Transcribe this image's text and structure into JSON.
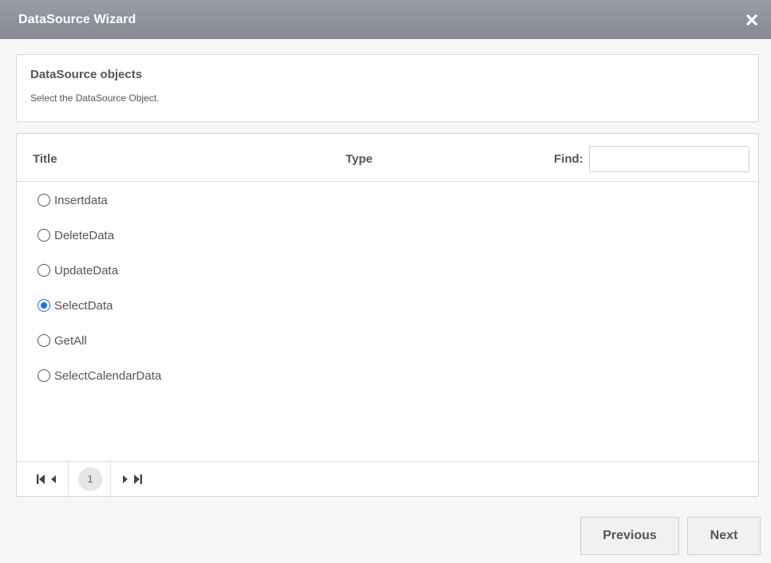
{
  "window": {
    "title": "DataSource Wizard",
    "close_icon": "close-icon"
  },
  "header": {
    "title": "DataSource objects",
    "subtitle": "Select the DataSource Object."
  },
  "grid": {
    "columns": {
      "title": "Title",
      "type": "Type"
    },
    "find": {
      "label": "Find:",
      "value": "",
      "placeholder": ""
    },
    "rows": [
      {
        "label": "Insertdata",
        "selected": false
      },
      {
        "label": "DeleteData",
        "selected": false
      },
      {
        "label": "UpdateData",
        "selected": false
      },
      {
        "label": "SelectData",
        "selected": true
      },
      {
        "label": "GetAll",
        "selected": false
      },
      {
        "label": "SelectCalendarData",
        "selected": false
      }
    ],
    "pager": {
      "current_page": "1",
      "icons": [
        "first-page-icon",
        "prev-page-icon",
        "next-page-icon",
        "last-page-icon"
      ]
    }
  },
  "footer": {
    "previous_label": "Previous",
    "next_label": "Next"
  },
  "colors": {
    "titlebar": "#8e9199",
    "accent": "#1a73e8",
    "background": "#f6f6f6"
  }
}
